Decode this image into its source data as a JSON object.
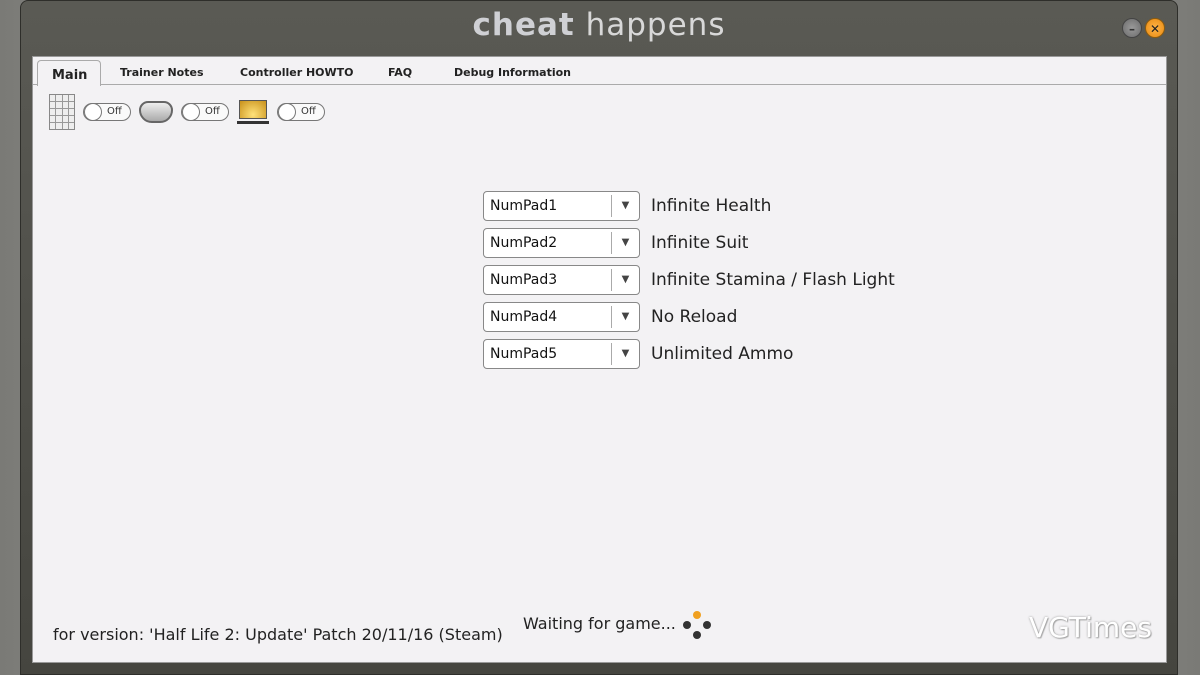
{
  "window": {
    "title_bold": "cheat",
    "title_rest": "happens"
  },
  "tabs": [
    {
      "label": "Main"
    },
    {
      "label": "Trainer Notes"
    },
    {
      "label": "Controller HOWTO"
    },
    {
      "label": "FAQ"
    },
    {
      "label": "Debug Information"
    }
  ],
  "toggles": [
    {
      "icon": "numpad-icon",
      "state": "Off"
    },
    {
      "icon": "gamepad-icon",
      "state": "Off"
    },
    {
      "icon": "laptop-icon",
      "state": "Off"
    }
  ],
  "cheats": [
    {
      "key": "NumPad1",
      "label": "Infinite Health"
    },
    {
      "key": "NumPad2",
      "label": "Infinite Suit"
    },
    {
      "key": "NumPad3",
      "label": "Infinite Stamina / Flash Light"
    },
    {
      "key": "NumPad4",
      "label": "No Reload"
    },
    {
      "key": "NumPad5",
      "label": "Unlimited Ammo"
    }
  ],
  "footer": {
    "version": "for version: 'Half Life 2: Update' Patch 20/11/16 (Steam)",
    "status": "Waiting for game..."
  },
  "watermark": "VGTimes",
  "colors": {
    "accent": "#f0a020"
  }
}
